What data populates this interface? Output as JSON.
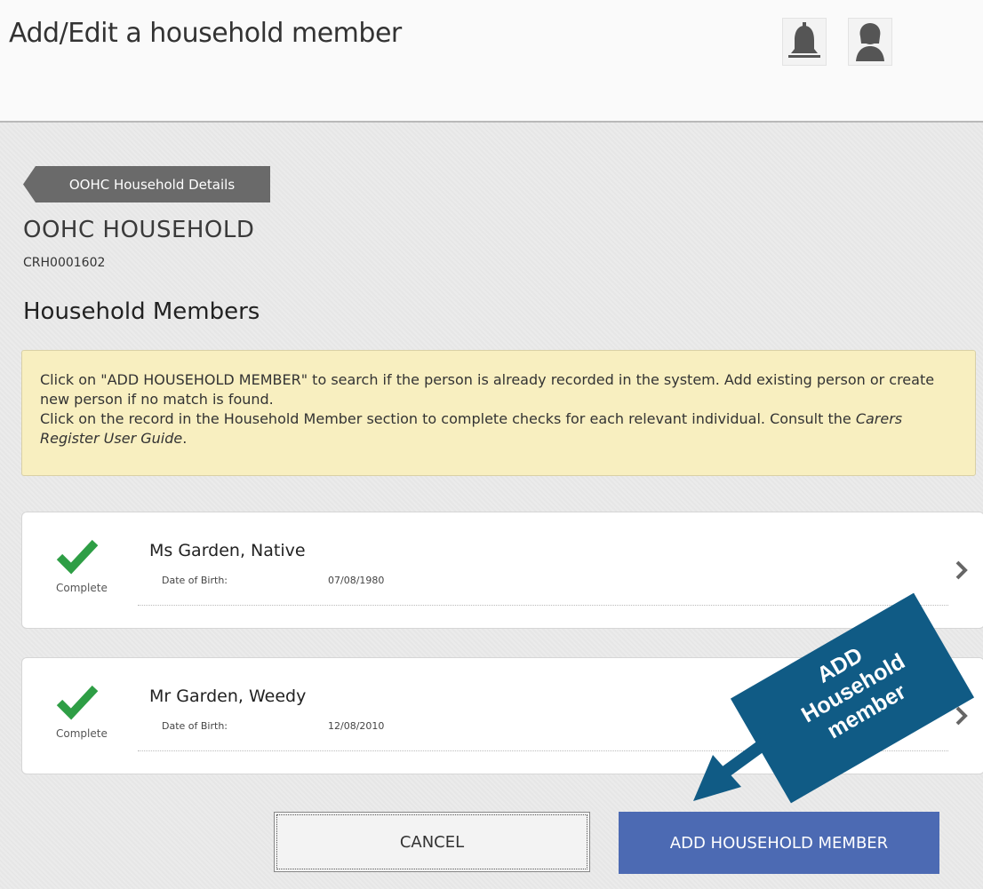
{
  "header": {
    "title": "Add/Edit a household member",
    "icons": [
      "bell-icon",
      "user-avatar-icon"
    ]
  },
  "breadcrumb": {
    "label": "OOHC Household Details"
  },
  "household": {
    "title": "OOHC HOUSEHOLD",
    "id": "CRH0001602"
  },
  "section": {
    "title": "Household Members"
  },
  "info": {
    "line1": "Click on \"ADD HOUSEHOLD MEMBER\" to search if the person is already recorded in the system. Add existing person or create new person if no match is found.",
    "line2_prefix": "Click on the record in the Household Member section to complete checks for each relevant individual. Consult the ",
    "line2_link": "Carers Register User Guide",
    "line2_suffix": "."
  },
  "members": [
    {
      "name": "Ms Garden, Native",
      "status": "Complete",
      "dob_label": "Date of Birth:",
      "dob": "07/08/1980"
    },
    {
      "name": "Mr Garden, Weedy",
      "status": "Complete",
      "dob_label": "Date of Birth:",
      "dob": "12/08/2010"
    }
  ],
  "actions": {
    "cancel_label": "CANCEL",
    "add_label": "ADD HOUSEHOLD MEMBER"
  },
  "callout": {
    "line1": "ADD",
    "line2": "Household",
    "line3": "member"
  },
  "colors": {
    "primary_button": "#4c6ab3",
    "check_green": "#2e9e45",
    "info_bg": "#f8efc0",
    "callout_bg": "#105b85"
  }
}
